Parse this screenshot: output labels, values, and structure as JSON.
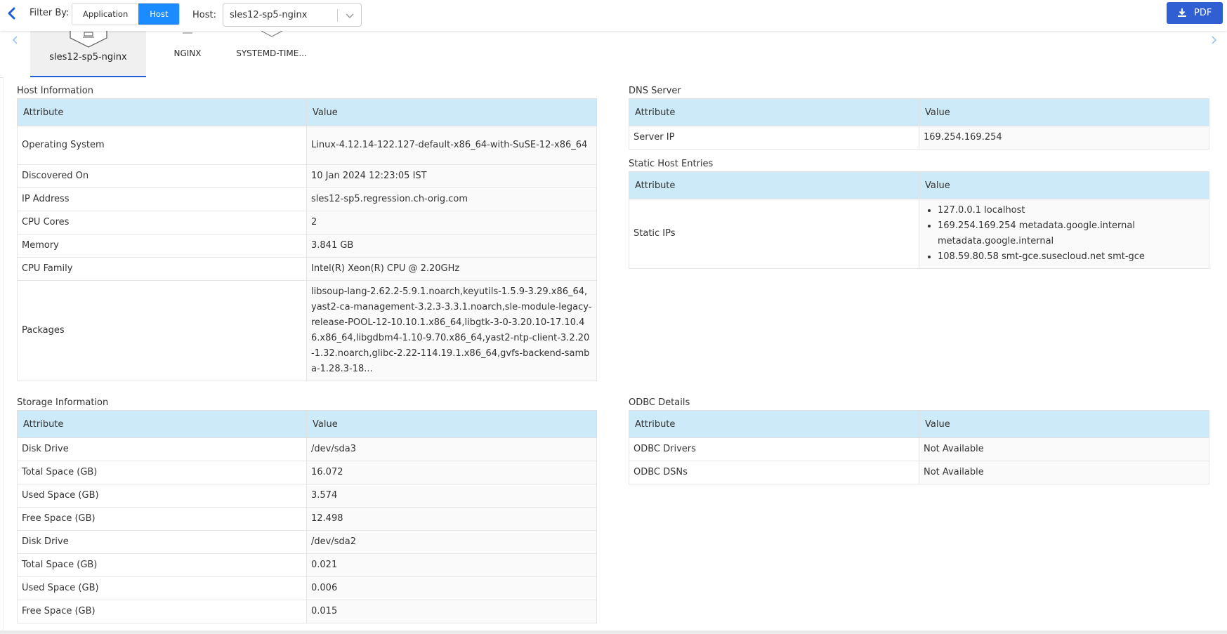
{
  "toolbar": {
    "filter_label": "Filter By:",
    "filter_options": [
      "Application",
      "Host"
    ],
    "selected_filter": "Host",
    "host_label": "Host:",
    "host_value": "sles12-sp5-nginx",
    "pdf_label": "PDF"
  },
  "tabs": [
    {
      "label": "sles12-sp5-nginx",
      "active": true
    },
    {
      "label": "NGINX",
      "active": false
    },
    {
      "label": "SYSTEMD-TIME...",
      "active": false
    }
  ],
  "host_information": {
    "title": "Host Information",
    "columns": [
      "Attribute",
      "Value"
    ],
    "rows": [
      {
        "attr": "Operating System",
        "value": "Linux-4.12.14-122.127-default-x86_64-with-SuSE-12-x86_64"
      },
      {
        "attr": "Discovered On",
        "value": "10 Jan 2024 12:23:05 IST"
      },
      {
        "attr": "IP Address",
        "value": "sles12-sp5.regression.ch-orig.com"
      },
      {
        "attr": "CPU Cores",
        "value": "2"
      },
      {
        "attr": "Memory",
        "value": "3.841 GB"
      },
      {
        "attr": "CPU Family",
        "value": "Intel(R) Xeon(R) CPU @ 2.20GHz"
      },
      {
        "attr": "Packages",
        "value": "libsoup-lang-2.62.2-5.9.1.noarch,keyutils-1.5.9-3.29.x86_64,yast2-ca-management-3.2.3-3.3.1.noarch,sle-module-legacy-release-POOL-12-10.10.1.x86_64,libgtk-3-0-3.20.10-17.10.46.x86_64,libgdbm4-1.10-9.70.x86_64,yast2-ntp-client-3.2.20-1.32.noarch,glibc-2.22-114.19.1.x86_64,gvfs-backend-samba-1.28.3-18..."
      }
    ]
  },
  "dns_server": {
    "title": "DNS Server",
    "columns": [
      "Attribute",
      "Value"
    ],
    "rows": [
      {
        "attr": "Server IP",
        "value": "169.254.169.254"
      }
    ]
  },
  "static_hosts": {
    "title": "Static Host Entries",
    "columns": [
      "Attribute",
      "Value"
    ],
    "attr": "Static IPs",
    "ips": [
      "127.0.0.1 localhost",
      "169.254.169.254 metadata.google.internal metadata.google.internal",
      "108.59.80.58 smt-gce.susecloud.net smt-gce"
    ]
  },
  "storage_information": {
    "title": "Storage Information",
    "columns": [
      "Attribute",
      "Value"
    ],
    "rows": [
      {
        "attr": "Disk Drive",
        "value": "/dev/sda3"
      },
      {
        "attr": "Total Space (GB)",
        "value": "16.072"
      },
      {
        "attr": "Used Space (GB)",
        "value": "3.574"
      },
      {
        "attr": "Free Space (GB)",
        "value": "12.498"
      },
      {
        "attr": "Disk Drive",
        "value": "/dev/sda2"
      },
      {
        "attr": "Total Space (GB)",
        "value": "0.021"
      },
      {
        "attr": "Used Space (GB)",
        "value": "0.006"
      },
      {
        "attr": "Free Space (GB)",
        "value": "0.015"
      }
    ]
  },
  "odbc_details": {
    "title": "ODBC Details",
    "columns": [
      "Attribute",
      "Value"
    ],
    "rows": [
      {
        "attr": "ODBC Drivers",
        "value": "Not Available"
      },
      {
        "attr": "ODBC DSNs",
        "value": "Not Available"
      }
    ]
  },
  "colors": {
    "accent": "#1a8cff",
    "pdf_button": "#2f5fd3",
    "table_header": "#cdeaf8",
    "active_tab_underline": "#1f5fd6"
  },
  "icons": [
    "chevron-left-icon",
    "chevron-down-icon",
    "download-icon",
    "server-icon",
    "hexagon-icon",
    "chevron-right-icon"
  ]
}
